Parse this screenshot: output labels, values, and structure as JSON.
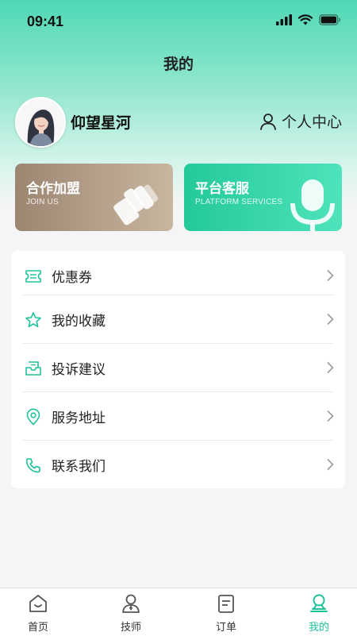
{
  "status_bar": {
    "time": "09:41"
  },
  "header": {
    "title": "我的"
  },
  "profile": {
    "username": "仰望星河",
    "center_link": "个人中心"
  },
  "cards": [
    {
      "title": "合作加盟",
      "subtitle": "JOIN US"
    },
    {
      "title": "平台客服",
      "subtitle": "PLATFORM SERVICES"
    }
  ],
  "menu": {
    "items": [
      {
        "label": "优惠券",
        "icon": "coupon-icon"
      },
      {
        "label": "我的收藏",
        "icon": "star-icon"
      },
      {
        "label": "投诉建议",
        "icon": "mailbox-icon"
      },
      {
        "label": "服务地址",
        "icon": "location-pin-icon"
      },
      {
        "label": "联系我们",
        "icon": "phone-icon"
      }
    ]
  },
  "tabbar": {
    "tabs": [
      {
        "label": "首页",
        "icon": "home-icon",
        "active": false
      },
      {
        "label": "技师",
        "icon": "technician-icon",
        "active": false
      },
      {
        "label": "订单",
        "icon": "order-icon",
        "active": false
      },
      {
        "label": "我的",
        "icon": "profile-icon",
        "active": true
      }
    ]
  },
  "colors": {
    "accent": "#1ec29a",
    "join_card": "#a8927d",
    "service_card": "#2fd1a4"
  }
}
